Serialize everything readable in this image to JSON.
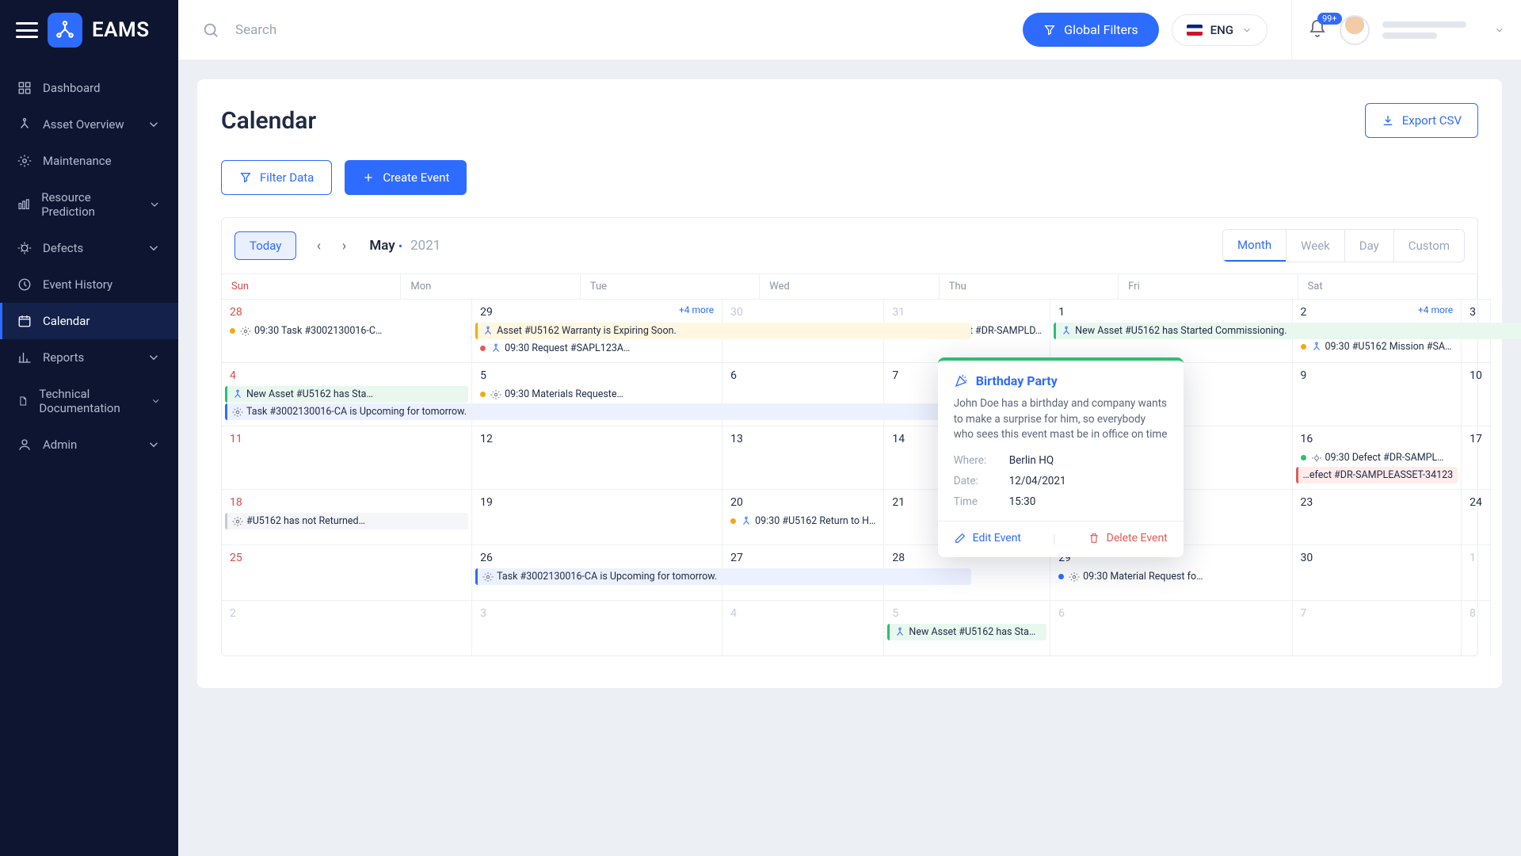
{
  "brand": {
    "name": "EAMS"
  },
  "topbar": {
    "search_placeholder": "Search",
    "global_filters": "Global Filters",
    "language": "ENG",
    "notif_badge": "99+"
  },
  "sidebar": {
    "items": [
      {
        "label": "Dashboard",
        "icon": "dashboard",
        "chev": false
      },
      {
        "label": "Asset Overview",
        "icon": "asset",
        "chev": true
      },
      {
        "label": "Maintenance",
        "icon": "gear",
        "chev": false
      },
      {
        "label": "Resource Prediction",
        "icon": "resource",
        "chev": true
      },
      {
        "label": "Defects",
        "icon": "bug",
        "chev": true
      },
      {
        "label": "Event History",
        "icon": "history",
        "chev": false
      },
      {
        "label": "Calendar",
        "icon": "calendar",
        "chev": false,
        "active": true
      },
      {
        "label": "Reports",
        "icon": "reports",
        "chev": true
      },
      {
        "label": "Technical Documentation",
        "icon": "doc",
        "chev": true
      },
      {
        "label": "Admin",
        "icon": "admin",
        "chev": true
      }
    ]
  },
  "page": {
    "title": "Calendar",
    "export": "Export CSV",
    "filter_data": "Filter Data",
    "create_event": "Create Event",
    "today": "Today",
    "month": "May",
    "year": "2021",
    "views": [
      "Month",
      "Week",
      "Day",
      "Custom"
    ],
    "active_view": "Month",
    "day_headers": [
      "Sun",
      "Mon",
      "Tue",
      "Wed",
      "Thu",
      "Fri",
      "Sat"
    ],
    "more_label": "+4 more"
  },
  "events": {
    "d28a": "09:30  Task #3002130016-C…",
    "d29a": "Asset #U5162 Warranty is Expiring Soon.",
    "d29b": "09:30  Request #SAPL123A…",
    "d31a": "09:30  Defect #DR-SAMPLD…",
    "d1a": "New Asset #U5162 has Started Commissioning.",
    "d2a": "09:30  #U5162 Mission #SA…",
    "d4a": "New Asset #U5162 has Sta…",
    "d4b": "Task #3002130016-CA is Upcoming for tomorrow.",
    "d5a": "09:30  Materials Requeste…",
    "d16a": "09:30  Defect #DR-SAMPL…",
    "d16b": "…efect #DR-SAMPLEASSET-34123",
    "d18a": "#U5162 has not Returned…",
    "d20a": "09:30  #U5162 Return to H…",
    "d26a": "Task #3002130016-CA is Upcoming for tomorrow.",
    "d29c": "09:30  Material Request fo…",
    "d5na": "New Asset #U5162 has Sta…"
  },
  "popover": {
    "title": "Birthday Party",
    "desc": "John Doe has a birthday and company wants to make a surprise for him, so everybody who sees this event mast be in office on time",
    "where_k": "Where:",
    "where_v": "Berlin HQ",
    "date_k": "Date:",
    "date_v": "12/04/2021",
    "time_k": "Time",
    "time_v": "15:30",
    "edit": "Edit Event",
    "delete": "Delete Event"
  }
}
